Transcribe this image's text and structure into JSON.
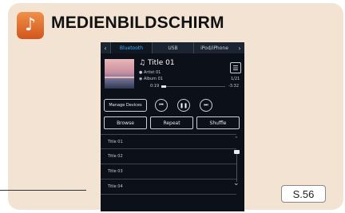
{
  "header": {
    "title": "MEDIENBILDSCHIRM",
    "icon": "music-note-icon"
  },
  "page_ref": "S.56",
  "screen": {
    "tabs": [
      {
        "label": "Bluetooth",
        "active": true
      },
      {
        "label": "USB",
        "active": false
      },
      {
        "label": "iPod/iPhone",
        "active": false
      }
    ],
    "now_playing": {
      "title": "Title 01",
      "artist": "Artist 01",
      "album": "Album 01",
      "track_count": "1/21",
      "time_current": "0:19",
      "time_remaining": "-3:32",
      "progress": 0.08
    },
    "buttons": {
      "manage_devices": "Manage Devices",
      "browse": "Browse",
      "repeat": "Repeat",
      "shuffle": "Shuffle"
    },
    "list": [
      "Title 01",
      "Title 02",
      "Title 03",
      "Title 04"
    ]
  },
  "colors": {
    "accent_tab": "#39b0ff",
    "icon_orange": "#e06a2a",
    "card": "#f2e3d3"
  }
}
